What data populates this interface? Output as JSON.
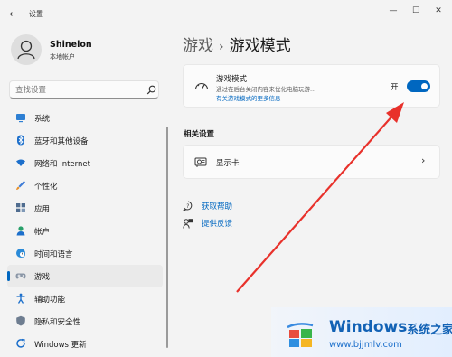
{
  "window": {
    "title": "设置",
    "back_glyph": "←",
    "minimize_glyph": "—",
    "maximize_glyph": "☐",
    "close_glyph": "✕"
  },
  "user": {
    "name": "Shinelon",
    "account_type": "本地帐户"
  },
  "search": {
    "placeholder": "查找设置"
  },
  "sidebar": {
    "items": [
      {
        "label": "系统",
        "icon": "monitor-icon"
      },
      {
        "label": "蓝牙和其他设备",
        "icon": "bluetooth-icon"
      },
      {
        "label": "网络和 Internet",
        "icon": "wifi-icon"
      },
      {
        "label": "个性化",
        "icon": "brush-icon"
      },
      {
        "label": "应用",
        "icon": "apps-icon"
      },
      {
        "label": "帐户",
        "icon": "person-icon"
      },
      {
        "label": "时间和语言",
        "icon": "globe-clock-icon"
      },
      {
        "label": "游戏",
        "icon": "gamepad-icon",
        "selected": true
      },
      {
        "label": "辅助功能",
        "icon": "accessibility-icon"
      },
      {
        "label": "隐私和安全性",
        "icon": "shield-icon"
      },
      {
        "label": "Windows 更新",
        "icon": "update-icon"
      }
    ]
  },
  "breadcrumb": {
    "parent": "游戏",
    "separator": "›",
    "current": "游戏模式"
  },
  "game_mode": {
    "title": "游戏模式",
    "description": "通过在后台关闭内容来优化电脑玩游...",
    "link": "有关游戏模式的更多信息",
    "toggle_label": "开",
    "toggle_on": true
  },
  "related": {
    "heading": "相关设置",
    "display_label": "显示卡",
    "chevron": "›"
  },
  "help": {
    "get_help": "获取帮助",
    "feedback": "提供反馈"
  },
  "watermark": {
    "brand": "Windows",
    "brand_cn": "系统之家",
    "url": "www.bjjmlv.com"
  },
  "colors": {
    "accent": "#0067c0",
    "arrow": "#e8312b"
  }
}
